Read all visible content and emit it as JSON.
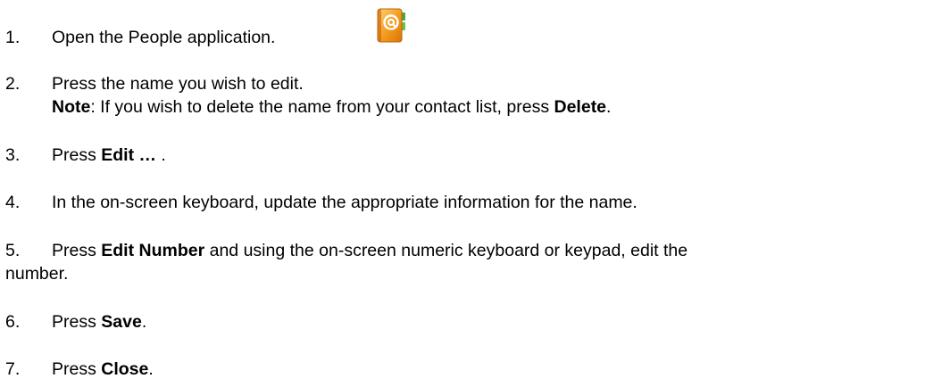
{
  "icons": {
    "people_app": "people-app-icon",
    "accent_orange": "#f39a1c",
    "accent_green": "#49a842"
  },
  "steps": [
    {
      "num": "1.",
      "text": "Open the People application."
    },
    {
      "num": "2.",
      "text": "Press the name you wish to edit.",
      "note_label": "Note",
      "note_text": ": If you wish to delete the name from your contact list, press ",
      "note_bold": "Delete",
      "note_end": "."
    },
    {
      "num": "3.",
      "pre": "Press ",
      "bold": "Edit …",
      "post": " ."
    },
    {
      "num": "4.",
      "text": "In the on-screen keyboard, update the appropriate information for the name."
    },
    {
      "num": "5.",
      "pre": "Press ",
      "bold": "Edit Number",
      "post": " and using the on-screen numeric keyboard or keypad, edit the",
      "cont": "number."
    },
    {
      "num": "6.",
      "pre": "Press ",
      "bold": "Save",
      "post": "."
    },
    {
      "num": "7.",
      "pre": "Press ",
      "bold": "Close",
      "post": "."
    }
  ]
}
